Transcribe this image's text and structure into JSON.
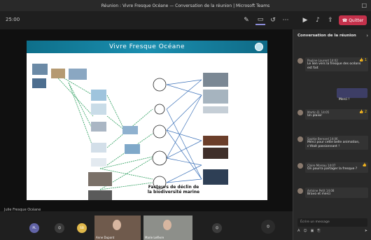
{
  "window": {
    "title": "Réunion : Vivre Fresque Océane — Conversation de la réunion | Microsoft Teams",
    "controls": "□"
  },
  "toolbar": {
    "timer": "25:00",
    "items": [
      "pen-icon",
      "screen-icon",
      "react-icon",
      "more-icon",
      "camera-icon",
      "mic-icon",
      "share-icon"
    ],
    "leave_label": "Quitter"
  },
  "slide": {
    "title": "Vivre Fresque Océane",
    "caption_line1": "Facteurs de déclin de",
    "caption_line2": "la biodiversité marine"
  },
  "presenter": {
    "name": "Julie Fresque Océane"
  },
  "chat": {
    "header": "Conversation de la réunion",
    "messages": [
      {
        "sender": "Pauline Laurent 14:02",
        "text": "Le lien vers la fresque des océans est fait",
        "reaction": "👍 1"
      },
      {
        "sender": "Martin D. 14:05",
        "text": "Un plaisir",
        "reaction": "👍 2"
      },
      {
        "sender": "Sophie Bernard 14:06",
        "text": "Merci pour cette belle animation, c'était passionnant !",
        "reaction": ""
      },
      {
        "sender": "Claire Moreau 14:07",
        "text": "On pourra partager la fresque ?",
        "reaction": "👍"
      },
      {
        "sender": "Antoine Petit 14:08",
        "text": "Bravo et merci",
        "reaction": ""
      }
    ],
    "own_message": "Merci !",
    "input_placeholder": "Écrire un message",
    "tools": [
      "format-icon",
      "emoji-icon",
      "gif-icon",
      "attach-icon",
      "send-icon"
    ]
  },
  "participants": [
    {
      "initials": "PL",
      "color": "#6264a7"
    },
    {
      "initials": "",
      "color": "#3b3b3b"
    },
    {
      "initials": "SB",
      "color": "#e0b84a"
    },
    {
      "initials": "",
      "color": "#3b3b3b"
    }
  ],
  "videos": [
    {
      "name": "Anne Dupont"
    },
    {
      "name": "Marie Lefèvre"
    }
  ]
}
